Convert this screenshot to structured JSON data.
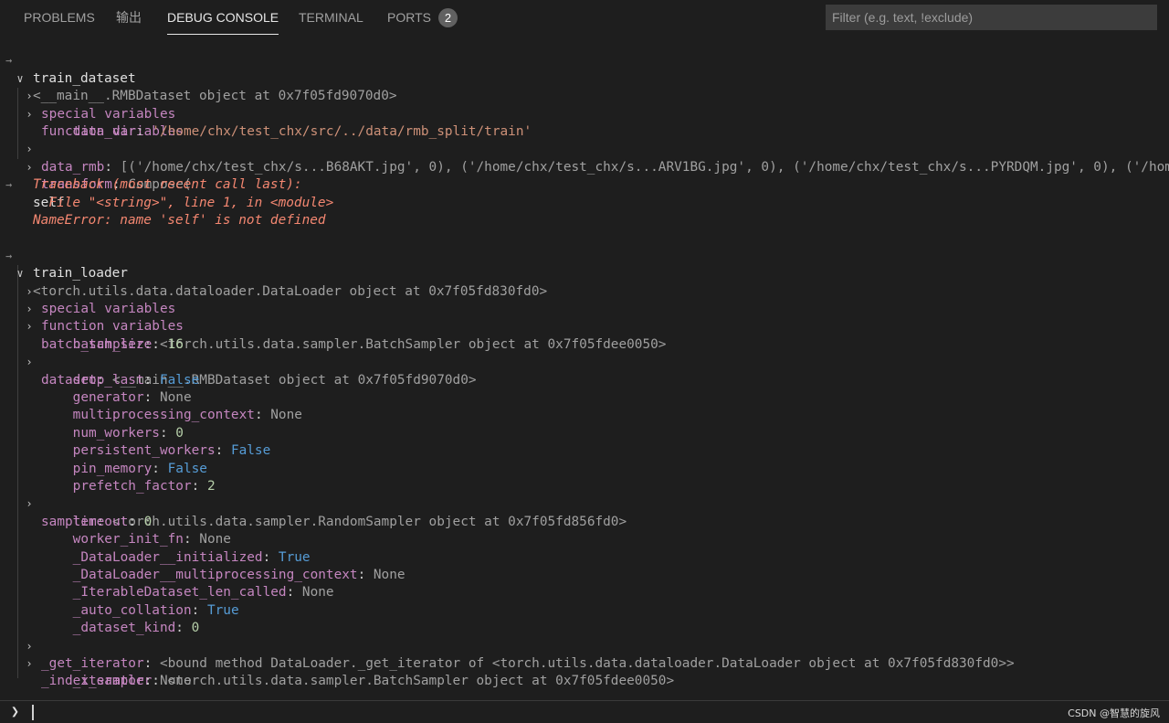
{
  "tabs": [
    {
      "label": "PROBLEMS",
      "active": false
    },
    {
      "label": "输出",
      "active": false
    },
    {
      "label": "DEBUG CONSOLE",
      "active": true
    },
    {
      "label": "TERMINAL",
      "active": false
    },
    {
      "label": "PORTS",
      "active": false,
      "badge": "2"
    }
  ],
  "filter": {
    "placeholder": "Filter (e.g. text, !exclude)"
  },
  "console": {
    "l1": "train_dataset",
    "l2": "<__main__.RMBDataset object at 0x7f05fd9070d0>",
    "l3": "special variables",
    "l4": "function variables",
    "l5k": "data_dir",
    "l5v": "'/home/chx/test_chx/src/../data/rmb_split/train'",
    "l6k": "data_rmb",
    "l6v": "[('/home/chx/test_chx/s...B68AKT.jpg', 0), ('/home/chx/test_chx/s...ARV1BG.jpg', 0), ('/home/chx/test_chx/s...PYRDQM.jpg', 0), ('/home/chx/test_chx/s",
    "l7k": "transform",
    "l7v": "Compose(",
    "l8": "self",
    "l9": "Traceback (most recent call last):",
    "l10": "  File \"<string>\", line 1, in <module>",
    "l11": "NameError: name 'self' is not defined",
    "l12": "train_loader",
    "l13": "<torch.utils.data.dataloader.DataLoader object at 0x7f05fd830fd0>",
    "l14": "special variables",
    "l15": "function variables",
    "l16k": "batch_sampler",
    "l16v": "<torch.utils.data.sampler.BatchSampler object at 0x7f05fdee0050>",
    "l17k": "batch_size",
    "l17v": "16",
    "l18k": "dataset",
    "l18v": "<__main__.RMBDataset object at 0x7f05fd9070d0>",
    "l19k": "drop_last",
    "l19v": "False",
    "l20k": "generator",
    "l20v": "None",
    "l21k": "multiprocessing_context",
    "l21v": "None",
    "l22k": "num_workers",
    "l22v": "0",
    "l23k": "persistent_workers",
    "l23v": "False",
    "l24k": "pin_memory",
    "l24v": "False",
    "l25k": "prefetch_factor",
    "l25v": "2",
    "l26k": "sampler",
    "l26v": "<torch.utils.data.sampler.RandomSampler object at 0x7f05fd856fd0>",
    "l27k": "timeout",
    "l27v": "0",
    "l28k": "worker_init_fn",
    "l28v": "None",
    "l29k": "_DataLoader__initialized",
    "l29v": "True",
    "l30k": "_DataLoader__multiprocessing_context",
    "l30v": "None",
    "l31k": "_IterableDataset_len_called",
    "l31v": "None",
    "l32k": "_auto_collation",
    "l32v": "True",
    "l33k": "_dataset_kind",
    "l33v": "0",
    "l34k": "_get_iterator",
    "l34v": "<bound method DataLoader._get_iterator of <torch.utils.data.dataloader.DataLoader object at 0x7f05fd830fd0>>",
    "l35k": "_index_sampler",
    "l35v": "<torch.utils.data.sampler.BatchSampler object at 0x7f05fdee0050>",
    "l36k": "_iterator",
    "l36v": "None"
  },
  "watermark": "CSDN @智慧的旋风",
  "colors": {
    "background": "#1e1e1e",
    "key": "#c586c0",
    "string": "#ce9178",
    "number": "#b5cea8",
    "boolean": "#569cd6",
    "error": "#f48771"
  }
}
